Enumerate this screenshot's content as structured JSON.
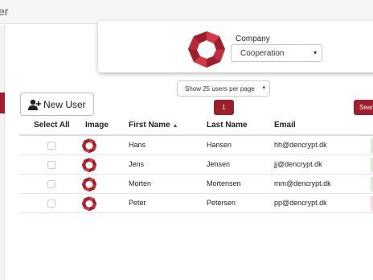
{
  "window": {
    "title_fragment": "er"
  },
  "company": {
    "label": "Company",
    "selected": "Cooperation"
  },
  "pagination": {
    "per_page": "Show 25 users per page",
    "current_page": "1"
  },
  "actions": {
    "new_user": "New User",
    "search": "Sear"
  },
  "table": {
    "headers": {
      "select_all": "Select All",
      "image": "Image",
      "first_name": "First Name",
      "last_name": "Last Name",
      "email": "Email"
    },
    "sort_column": "first_name",
    "rows": [
      {
        "first": "Hans",
        "last": "Hansen",
        "email": "hh@dencrypt.dk",
        "status_color": "#d8ecd6"
      },
      {
        "first": "Jens",
        "last": "Jensen",
        "email": "jj@dencrypt.dk",
        "status_color": "#d8ecd6"
      },
      {
        "first": "Morten",
        "last": "Mortensen",
        "email": "mm@dencrypt.dk",
        "status_color": "#d8ecd6"
      },
      {
        "first": "Peter",
        "last": "Petersen",
        "email": "pp@dencrypt.dk",
        "status_color": "#f1dcdf"
      }
    ]
  },
  "colors": {
    "accent": "#9e1f2b",
    "logo_dark": "#9e1f2b",
    "logo_light": "#d23a48"
  },
  "icons": {
    "sort": "caret-up-icon",
    "new_user": "user-plus-icon",
    "select": "chevron-down-icon"
  }
}
